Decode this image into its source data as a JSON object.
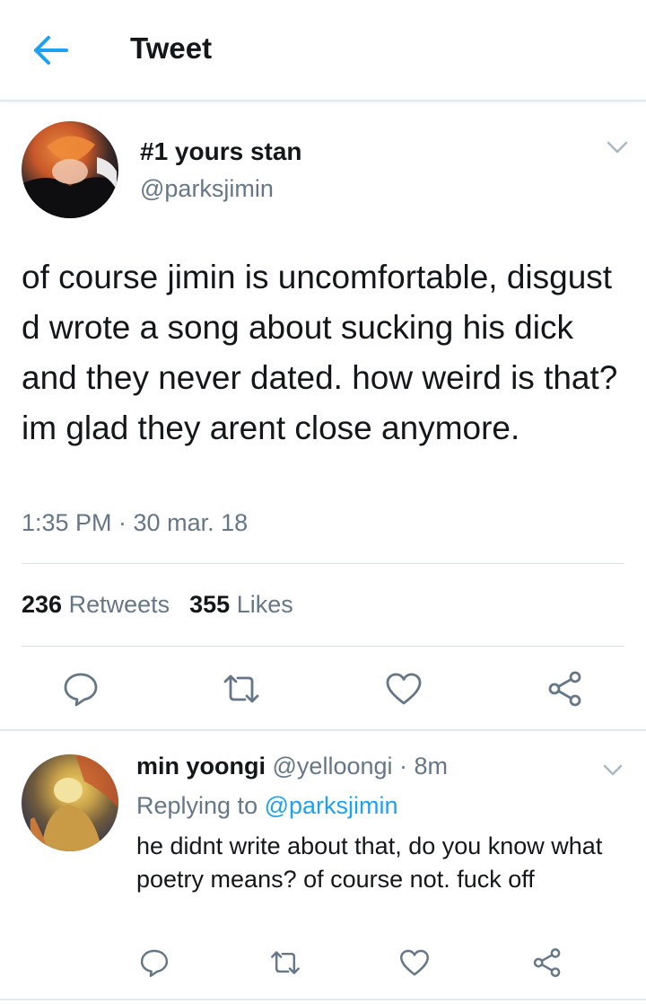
{
  "header": {
    "title": "Tweet",
    "back_icon": "arrow-left-icon"
  },
  "colors": {
    "accent": "#1da1f2",
    "secondary_text": "#657786",
    "primary_text": "#14171a",
    "divider": "#e1e8ed"
  },
  "main_tweet": {
    "author_name": "#1 yours stan",
    "handle": "@parksjimin",
    "text": "of course jimin is uncomfortable, disgust d wrote a song about sucking his dick and they never dated. how weird is that? im glad they arent close anymore.",
    "timestamp": "1:35 PM · 30 mar. 18",
    "retweets_count": "236",
    "retweets_label": "Retweets",
    "likes_count": "355",
    "likes_label": "Likes",
    "actions": [
      "reply-icon",
      "retweet-icon",
      "like-icon",
      "share-icon"
    ]
  },
  "reply": {
    "author_name": "min yoongi",
    "handle_and_time": "@yelloongi · 8m",
    "replying_prefix": "Replying to",
    "replying_to": "@parksjimin",
    "text": "he didnt write about that, do you know what poetry means? of course not. fuck off",
    "actions": [
      "reply-icon",
      "retweet-icon",
      "like-icon",
      "share-icon"
    ]
  }
}
